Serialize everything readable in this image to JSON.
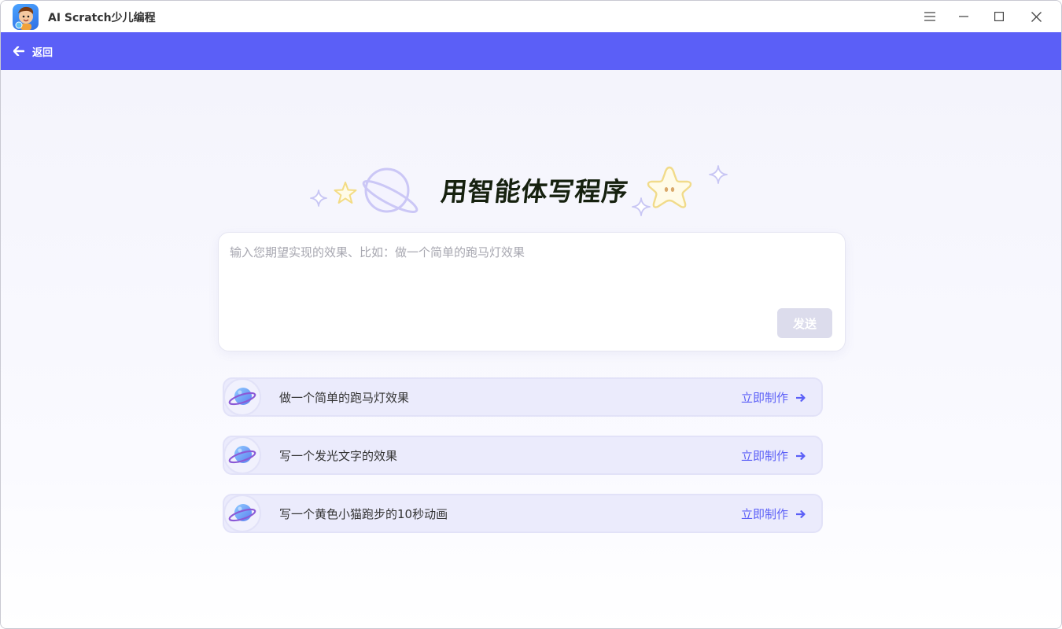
{
  "window": {
    "title": "AI Scratch少儿编程",
    "controls": [
      "menu",
      "minimize",
      "maximize",
      "close"
    ]
  },
  "nav": {
    "back_label": "返回",
    "color": "#5b5ff7"
  },
  "hero": {
    "title": "用智能体写程序"
  },
  "prompt": {
    "placeholder": "输入您期望实现的效果、比如：做一个简单的跑马灯效果",
    "value": "",
    "send_label": "发送"
  },
  "suggestions": [
    {
      "text": "做一个简单的跑马灯效果",
      "action": "立即制作"
    },
    {
      "text": "写一个发光文字的效果",
      "action": "立即制作"
    },
    {
      "text": "写一个黄色小猫跑步的10秒动画",
      "action": "立即制作"
    }
  ],
  "icons": {
    "logo": "kid-mascot-logo",
    "menu": "hamburger-icon",
    "minimize": "minimize-icon",
    "maximize": "maximize-icon",
    "close": "close-icon",
    "back": "arrow-left-icon",
    "suggestion": "planet-icon",
    "action": "arrow-right-icon"
  }
}
